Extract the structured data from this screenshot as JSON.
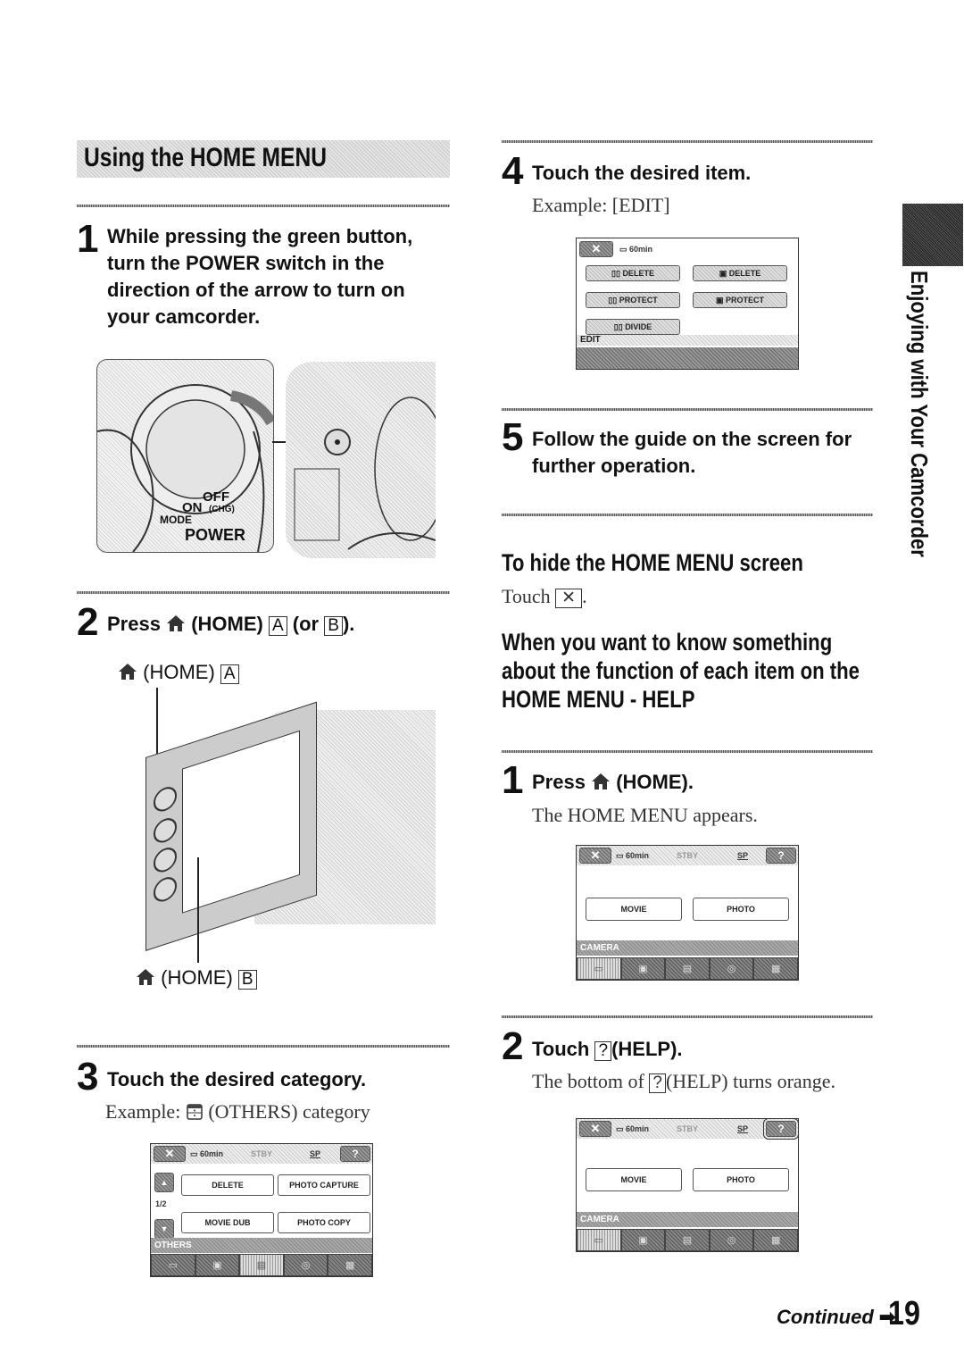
{
  "section_banner": "Using the HOME MENU",
  "side_tab": "Enjoying with Your Camcorder",
  "steps_left": [
    {
      "num": "1",
      "text": [
        "While pressing the green button,",
        "turn the POWER switch in the",
        "direction of the arrow to turn on",
        "your camcorder."
      ]
    },
    {
      "num": "2",
      "text_prefix": "Press",
      "text_middle": "(HOME)",
      "box_a": "A",
      "text_or": "(or",
      "box_b": "B",
      "text_end": ")."
    },
    {
      "num": "3",
      "text": "Touch the desired category.",
      "example_prefix": "Example:",
      "example_suffix": "(OTHERS) category"
    }
  ],
  "illustration_power": {
    "labels": {
      "off": "OFF",
      "chg": "(CHG)",
      "on": "ON",
      "mode": "MODE",
      "power": "POWER"
    }
  },
  "illustration_home": {
    "label_a_text": "(HOME)",
    "label_a_box": "A",
    "label_b_text": "(HOME)",
    "label_b_box": "B"
  },
  "lcd_others": {
    "close": "✕",
    "battery": "60min",
    "status": "STBY",
    "quality": "SP",
    "help": "?",
    "page": "1/2",
    "buttons": [
      "DELETE",
      "PHOTO CAPTURE",
      "MOVIE DUB",
      "PHOTO COPY"
    ],
    "category": "OTHERS"
  },
  "steps_right": [
    {
      "num": "4",
      "text": "Touch the desired item.",
      "example": "Example: [EDIT]"
    },
    {
      "num": "5",
      "text": [
        "Follow the guide on the screen for",
        "further operation."
      ]
    }
  ],
  "lcd_edit": {
    "close": "✕",
    "battery": "60min",
    "buttons": [
      "DELETE",
      "DELETE",
      "PROTECT",
      "PROTECT",
      "DIVIDE"
    ],
    "category": "EDIT"
  },
  "hide_section": {
    "heading": "To hide the HOME MENU screen",
    "text": "Touch",
    "box": "✕",
    "end": "."
  },
  "help_section": {
    "heading": [
      "When you want to know something",
      "about the function of each item on the",
      "HOME MENU - HELP"
    ],
    "step1": {
      "num": "1",
      "prefix": "Press",
      "suffix": "(HOME).",
      "desc": "The HOME MENU appears."
    },
    "step2": {
      "num": "2",
      "prefix": "Touch",
      "box": "?",
      "suffix": "(HELP).",
      "desc_prefix": "The bottom of",
      "desc_box": "?",
      "desc_suffix": "(HELP) turns orange."
    }
  },
  "lcd_camera": {
    "close": "✕",
    "battery": "60min",
    "status": "STBY",
    "quality": "SP",
    "help": "?",
    "buttons": [
      "MOVIE",
      "PHOTO"
    ],
    "category": "CAMERA"
  },
  "footer": {
    "continued": "Continued",
    "arrow": "➡",
    "page_number": "19"
  }
}
